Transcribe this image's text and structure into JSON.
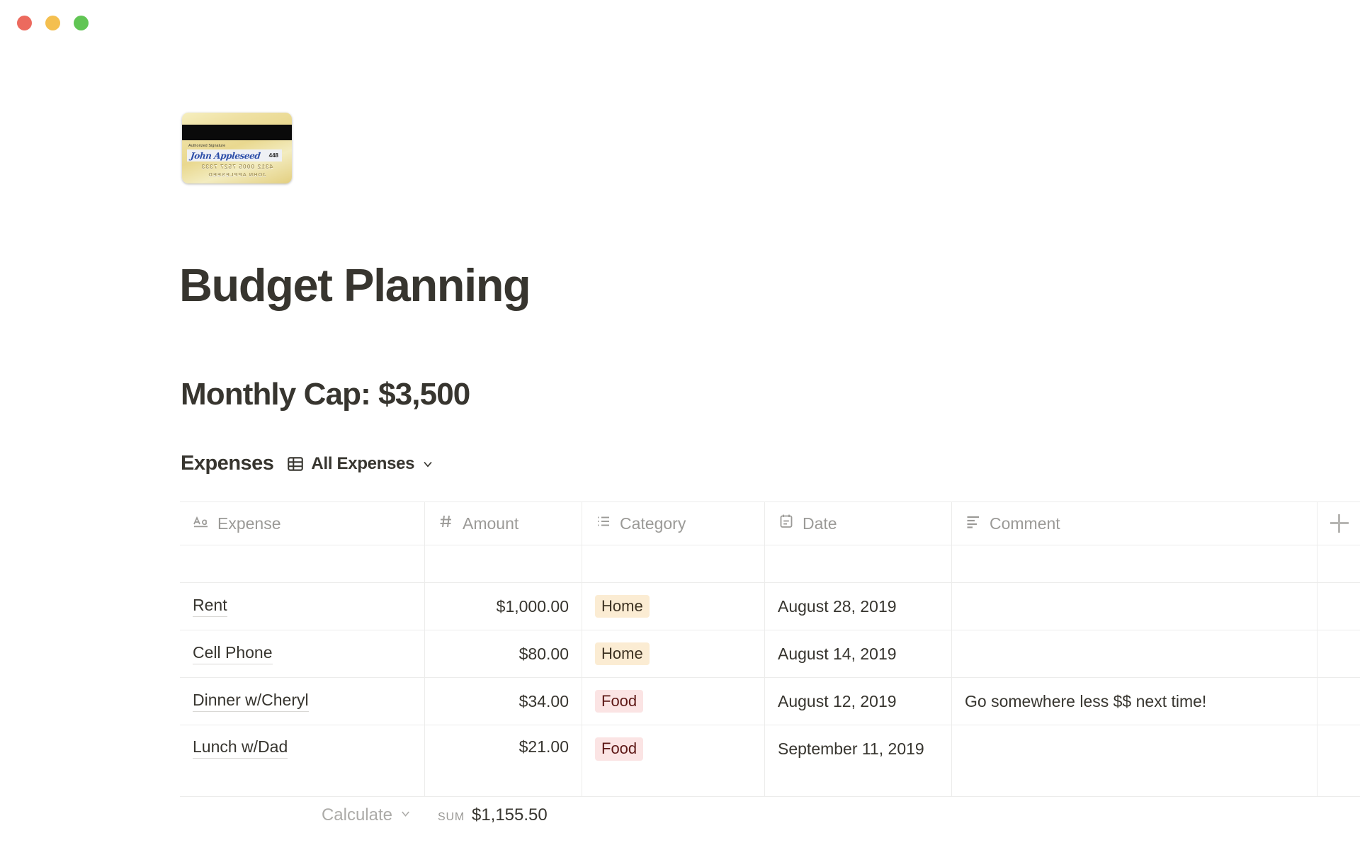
{
  "window": {
    "traffic_lights": [
      {
        "name": "close",
        "color": "#ec6a5e"
      },
      {
        "name": "minimize",
        "color": "#f4bf4f"
      },
      {
        "name": "maximize",
        "color": "#61c554"
      }
    ]
  },
  "cover": {
    "icon_name": "credit-card-image",
    "auth_label": "Authorized Signature",
    "signature": "John Appleseed",
    "cvv": "448",
    "embossed_number": "4312 0005 7527 7333",
    "embossed_name": "JOHN APPLESEED"
  },
  "document": {
    "title": "Budget Planning",
    "subtitle": "Monthly Cap: $3,500"
  },
  "database": {
    "name": "Expenses",
    "view_label": "All Expenses",
    "view_icon": "table-icon",
    "chevron_icon": "chevron-down-icon",
    "add_column_icon": "plus-icon",
    "columns": [
      {
        "label": "Expense",
        "icon": "text-aa-icon",
        "type": "title"
      },
      {
        "label": "Amount",
        "icon": "number-hash-icon",
        "type": "number"
      },
      {
        "label": "Category",
        "icon": "select-list-icon",
        "type": "select"
      },
      {
        "label": "Date",
        "icon": "calendar-icon",
        "type": "date"
      },
      {
        "label": "Comment",
        "icon": "text-lines-icon",
        "type": "text"
      }
    ],
    "rows": [
      {
        "expense": "",
        "amount": "",
        "category": "",
        "date": "",
        "comment": ""
      },
      {
        "expense": "Rent",
        "amount": "$1,000.00",
        "category": "Home",
        "date": "August 28, 2019",
        "comment": ""
      },
      {
        "expense": "Cell Phone",
        "amount": "$80.00",
        "category": "Home",
        "date": "August 14, 2019",
        "comment": ""
      },
      {
        "expense": "Dinner w/Cheryl",
        "amount": "$34.00",
        "category": "Food",
        "date": "August 12, 2019",
        "comment": "Go somewhere less $$ next time!"
      },
      {
        "expense": "Lunch w/Dad",
        "amount": "$21.00",
        "category": "Food",
        "date": "September 11, 2019",
        "comment": ""
      }
    ],
    "footer": {
      "calculate_label": "Calculate",
      "calculate_chevron": "chevron-down-icon",
      "sum_label": "SUM",
      "sum_value": "$1,155.50"
    },
    "tag_colors": {
      "Home": "#fbecd3",
      "Food": "#fbe4e4"
    }
  }
}
